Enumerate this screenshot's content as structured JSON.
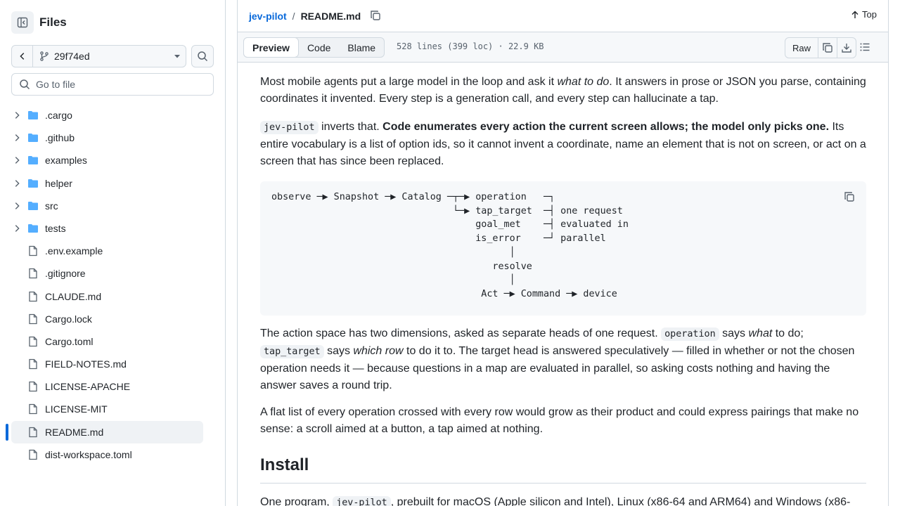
{
  "sidebar": {
    "title": "Files",
    "branch": "29f74ed",
    "goto_placeholder": "Go to file",
    "items": [
      {
        "label": ".cargo",
        "type": "folder"
      },
      {
        "label": ".github",
        "type": "folder"
      },
      {
        "label": "examples",
        "type": "folder"
      },
      {
        "label": "helper",
        "type": "folder"
      },
      {
        "label": "src",
        "type": "folder"
      },
      {
        "label": "tests",
        "type": "folder"
      },
      {
        "label": ".env.example",
        "type": "file"
      },
      {
        "label": ".gitignore",
        "type": "file"
      },
      {
        "label": "CLAUDE.md",
        "type": "file"
      },
      {
        "label": "Cargo.lock",
        "type": "file"
      },
      {
        "label": "Cargo.toml",
        "type": "file"
      },
      {
        "label": "FIELD-NOTES.md",
        "type": "file"
      },
      {
        "label": "LICENSE-APACHE",
        "type": "file"
      },
      {
        "label": "LICENSE-MIT",
        "type": "file"
      },
      {
        "label": "README.md",
        "type": "file",
        "active": true
      },
      {
        "label": "dist-workspace.toml",
        "type": "file"
      }
    ]
  },
  "header": {
    "repo": "jev-pilot",
    "separator": "/",
    "file": "README.md",
    "top_label": "Top"
  },
  "toolbar": {
    "tabs": [
      "Preview",
      "Code",
      "Blame"
    ],
    "active_tab": "Preview",
    "meta": "528 lines (399 loc) · 22.9 KB",
    "raw_label": "Raw"
  },
  "article": {
    "p1": {
      "a": "Most mobile agents put a large model in the loop and ask it ",
      "em": "what to do",
      "b": ". It answers in prose or JSON you parse, containing coordinates it invented. Every step is a generation call, and every step can hallucinate a tap."
    },
    "p2": {
      "code": "jev-pilot",
      "a": " inverts that. ",
      "strong": "Code enumerates every action the current screen allows; the model only picks one.",
      "b": " Its entire vocabulary is a list of option ids, so it cannot invent a coordinate, name an element that is not on screen, or act on a screen that has since been replaced."
    },
    "diagram": "observe ─▶ Snapshot ─▶ Catalog ─┬─▶ operation   ─┐\n                                └─▶ tap_target  ─┤ one request\n                                    goal_met    ─┤ evaluated in\n                                    is_error    ─┘ parallel\n                                          │\n                                       resolve\n                                          │\n                                     Act ─▶ Command ─▶ device",
    "p3": {
      "a": "The action space has two dimensions, asked as separate heads of one request. ",
      "code1": "operation",
      "b": " says ",
      "em1": "what",
      "c": " to do; ",
      "code2": "tap_target",
      "d": " says ",
      "em2": "which row",
      "e": " to do it to. The target head is answered speculatively — filled in whether or not the chosen operation needs it — because questions in a map are evaluated in parallel, so asking costs nothing and having the answer saves a round trip."
    },
    "p4": "A flat list of every operation crossed with every row would grow as their product and could express pairings that make no sense: a scroll aimed at a button, a tap aimed at nothing.",
    "h2": "Install",
    "p5": {
      "a": "One program, ",
      "code": "jev-pilot",
      "b": ", prebuilt for macOS (Apple silicon and Intel), Linux (x86-64 and ARM64) and Windows (x86-"
    }
  }
}
